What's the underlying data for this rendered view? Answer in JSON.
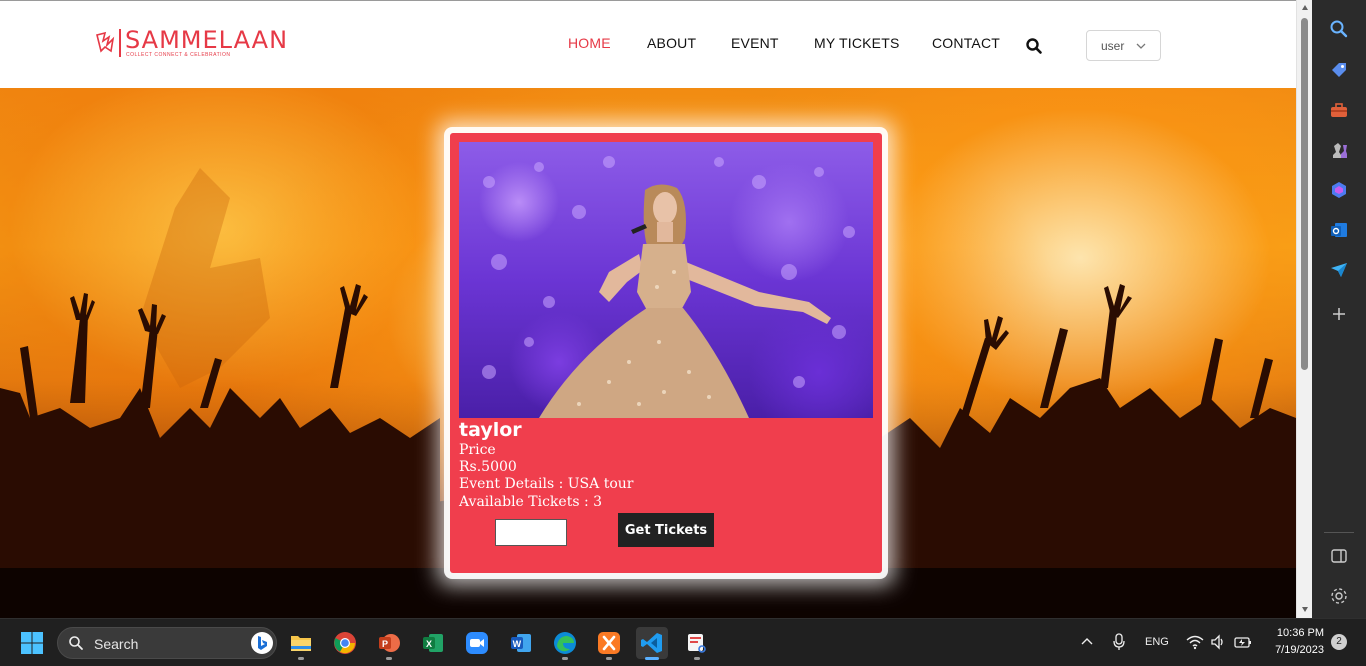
{
  "site": {
    "logo_text": "SAMMELAAN",
    "logo_tagline": "COLLECT CONNECT & CELEBRATION"
  },
  "nav": {
    "items": [
      {
        "label": "HOME",
        "active": true
      },
      {
        "label": "ABOUT",
        "active": false
      },
      {
        "label": "EVENT",
        "active": false
      },
      {
        "label": "MY TICKETS",
        "active": false
      },
      {
        "label": "CONTACT",
        "active": false
      }
    ],
    "search_icon": "search-icon",
    "user_select": {
      "selected": "user"
    }
  },
  "event": {
    "name": "taylor",
    "price_label": "Price",
    "price_value": "Rs.5000",
    "details": "Event Details : USA tour",
    "available": "Available Tickets : 3",
    "quantity_value": "",
    "button_label": "Get Tickets"
  },
  "colors": {
    "brand": "#e63946",
    "card": "#f03e4d",
    "button": "#222222"
  },
  "sidebar": {
    "icons": [
      "search-icon",
      "tag-icon",
      "toolbox-icon",
      "chess-icon",
      "copilot-icon",
      "outlook-icon",
      "send-icon",
      "add-icon",
      "sidebar-toggle-icon",
      "settings-icon"
    ]
  },
  "taskbar": {
    "search_label": "Search",
    "apps": [
      "file-explorer-icon",
      "chrome-icon",
      "powerpoint-icon",
      "excel-icon",
      "zoom-icon",
      "word-icon",
      "edge-icon",
      "xampp-icon",
      "vscode-icon",
      "snipping-tool-icon"
    ],
    "tray": {
      "language": "ENG",
      "time": "10:36 PM",
      "date": "7/19/2023",
      "notifications": "2"
    }
  }
}
